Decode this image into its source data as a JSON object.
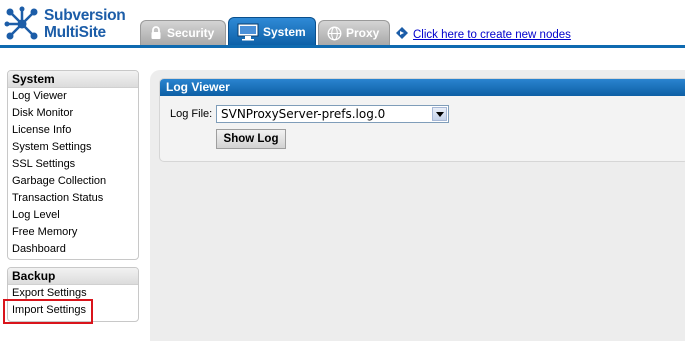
{
  "app": {
    "logo_line1": "Subversion",
    "logo_line2": "MultiSite",
    "brand_color": "#1c5da8"
  },
  "tabs": [
    {
      "label": "Security",
      "icon": "lock-icon",
      "active": false
    },
    {
      "label": "System",
      "icon": "monitor-icon",
      "active": true
    },
    {
      "label": "Proxy",
      "icon": "globe-icon",
      "active": false
    }
  ],
  "create_link": {
    "label": "Click here to create new nodes",
    "icon": "diamond-arrow-icon"
  },
  "sidebar": {
    "system": {
      "title": "System",
      "items": [
        "Log Viewer",
        "Disk Monitor",
        "License Info",
        "System Settings",
        "SSL Settings",
        "Garbage Collection",
        "Transaction Status",
        "Log Level",
        "Free Memory",
        "Dashboard"
      ]
    },
    "backup": {
      "title": "Backup",
      "items": [
        "Export Settings",
        "Import Settings"
      ]
    },
    "highlighted_item": "Import Settings",
    "highlight_color": "#d9141b"
  },
  "log_viewer": {
    "title": "Log Viewer",
    "log_file_label": "Log File:",
    "log_file_value": "SVNProxyServer-prefs.log.0",
    "show_log_button": "Show Log"
  }
}
